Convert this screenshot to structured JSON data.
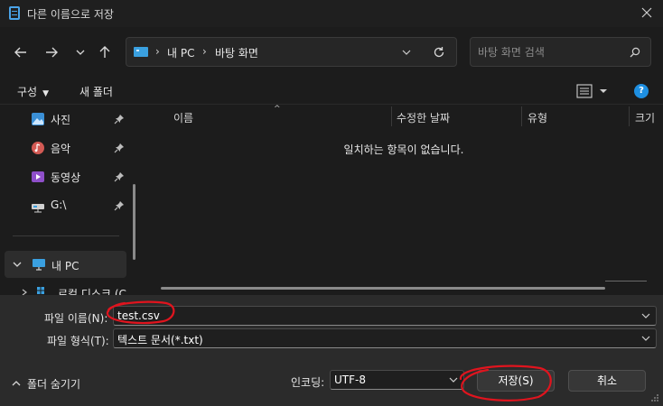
{
  "window": {
    "title": "다른 이름으로 저장"
  },
  "breadcrumb": {
    "items": [
      "내 PC",
      "바탕 화면"
    ],
    "separator": "›"
  },
  "search": {
    "placeholder": "바탕 화면 검색"
  },
  "toolbar": {
    "organize_label": "구성",
    "new_folder_label": "새 폴더",
    "help_label": "?"
  },
  "sidebar": {
    "items": [
      {
        "label": "사진",
        "icon": "photos-icon",
        "pinned": true
      },
      {
        "label": "음악",
        "icon": "music-icon",
        "pinned": true
      },
      {
        "label": "동영상",
        "icon": "videos-icon",
        "pinned": true
      },
      {
        "label": "G:\\",
        "icon": "network-drive-icon",
        "pinned": true
      }
    ],
    "this_pc_label": "내 PC",
    "local_disk_label": "로컬 디스크 (C"
  },
  "file_list": {
    "columns": [
      "이름",
      "수정한 날짜",
      "유형",
      "크기"
    ],
    "empty_message": "일치하는 항목이 없습니다."
  },
  "form": {
    "filename_label": "파일 이름(N):",
    "filename_value": "test.csv",
    "filetype_label": "파일 형식(T):",
    "filetype_value": "텍스트 문서(*.txt)",
    "encoding_label": "인코딩:",
    "encoding_value": "UTF-8"
  },
  "buttons": {
    "toggle_folders": "폴더 숨기기",
    "save": "저장(S)",
    "cancel": "취소"
  },
  "colors": {
    "accent": "#1e8fe1",
    "annotation": "#e0141e",
    "background": "#1c1c1c",
    "bottom_panel": "#2b2b2b"
  }
}
